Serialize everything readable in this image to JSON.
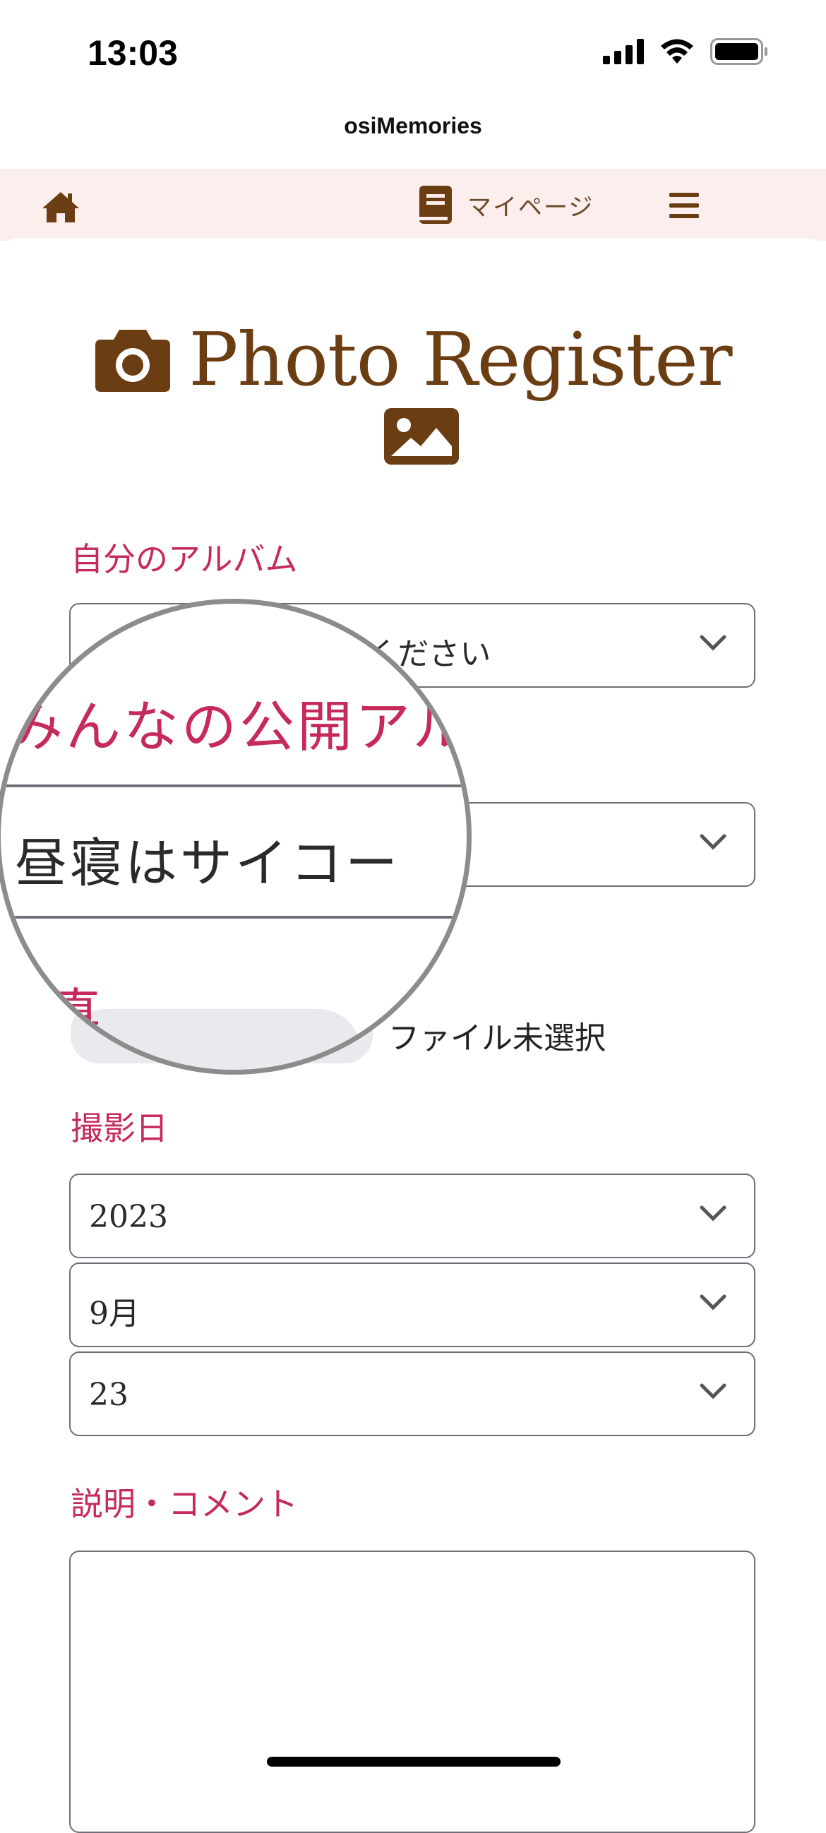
{
  "status": {
    "time": "13:03"
  },
  "app": {
    "title": "osiMemories"
  },
  "nav": {
    "home_icon": "home-icon",
    "mypage_label": "マイページ",
    "mypage_icon": "book-icon",
    "menu_icon": "hamburger-icon"
  },
  "page": {
    "title": "Photo Register",
    "title_icon": "camera-icon",
    "sub_icon": "image-icon"
  },
  "form": {
    "my_album": {
      "label": "自分のアルバム",
      "value": "ーーーーーーーしてください"
    },
    "public_album": {
      "label": "みんなの公開アル",
      "value": "昼寝はサイコー"
    },
    "photo": {
      "label_fragment": "真",
      "file_status": "ファイル未選択"
    },
    "date": {
      "label": "撮影日",
      "year": "2023",
      "month": "9月",
      "day": "23"
    },
    "comment": {
      "label": "説明・コメント",
      "value": ""
    }
  },
  "colors": {
    "label": "#c62a5a",
    "brand_brown": "#6b3d12",
    "nav_bg": "#fdeeee"
  }
}
